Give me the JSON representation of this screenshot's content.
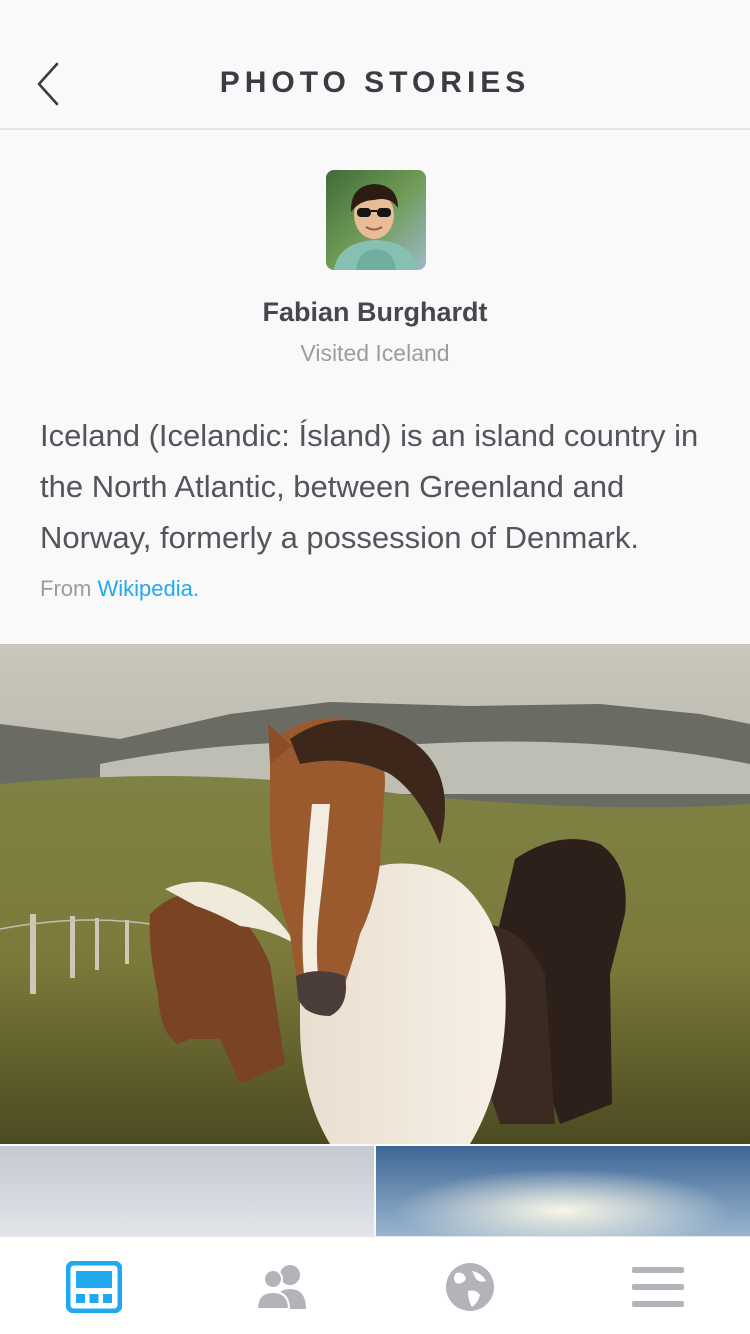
{
  "header": {
    "title": "PHOTO STORIES",
    "back_icon": "chevron-left-icon"
  },
  "author": {
    "name": "Fabian Burghardt",
    "subtitle": "Visited Iceland"
  },
  "story": {
    "description": "Iceland (Icelandic: Ísland) is an island country in the North Atlantic, between Greenland and Norway, formerly a possession of Denmark.",
    "source_prefix": "From",
    "source_link": "Wikipedia."
  },
  "tabbar": {
    "active_color": "#20a9f0",
    "inactive_color": "#b2b4b9",
    "items": [
      {
        "icon": "dashboard-icon",
        "active": true
      },
      {
        "icon": "people-icon",
        "active": false
      },
      {
        "icon": "globe-icon",
        "active": false
      },
      {
        "icon": "menu-icon",
        "active": false
      }
    ]
  }
}
